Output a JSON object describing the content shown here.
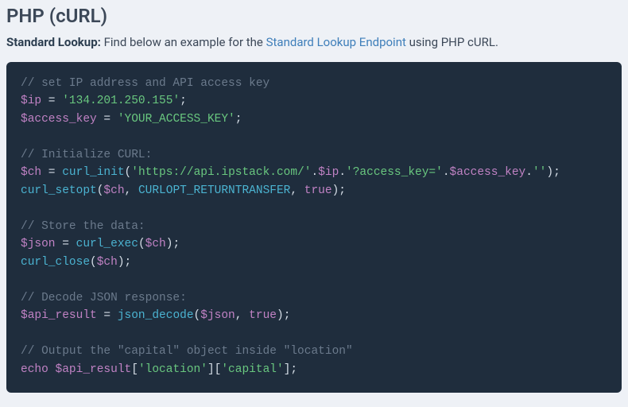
{
  "title": "PHP (cURL)",
  "lead": {
    "strong": "Standard Lookup:",
    "before_link": " Find below an example for the ",
    "link_text": "Standard Lookup Endpoint",
    "after_link": " using PHP cURL."
  },
  "code": {
    "c1": "// set IP address and API access key",
    "ip_var": "$ip",
    "eq": " = ",
    "ip_val": "'134.201.250.155'",
    "semi": ";",
    "ak_var": "$access_key",
    "ak_val": "'YOUR_ACCESS_KEY'",
    "c2": "// Initialize CURL:",
    "ch_var": "$ch",
    "curl_init": "curl_init",
    "url1": "'https://api.ipstack.com/'",
    "dot": ".",
    "url2": "'?access_key='",
    "url3": "''",
    "curl_setopt": "curl_setopt",
    "ret_const": "CURLOPT_RETURNTRANSFER",
    "true": "true",
    "c3": "// Store the data:",
    "json_var": "$json",
    "curl_exec": "curl_exec",
    "curl_close": "curl_close",
    "c4": "// Decode JSON response:",
    "api_var": "$api_result",
    "json_decode": "json_decode",
    "c5": "// Output the \"capital\" object inside \"location\"",
    "echo": "echo",
    "loc_key": "'location'",
    "cap_key": "'capital'"
  }
}
